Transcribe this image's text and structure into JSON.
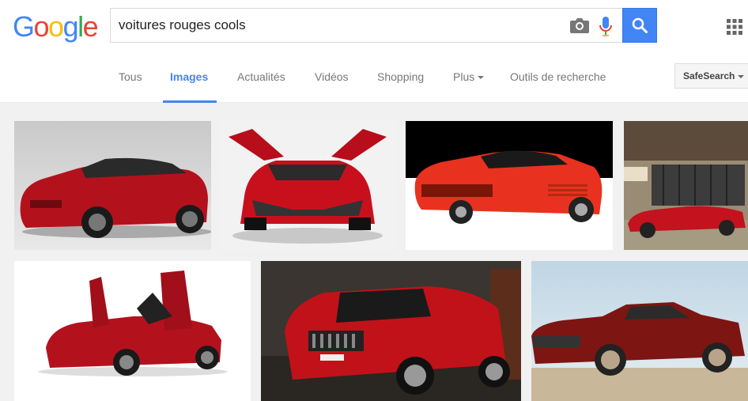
{
  "logo": {
    "letters": [
      "G",
      "o",
      "o",
      "g",
      "l",
      "e"
    ],
    "colors": [
      "#4285f4",
      "#ea4335",
      "#fbbc05",
      "#4285f4",
      "#34a853",
      "#ea4335"
    ]
  },
  "search": {
    "query": "voitures rouges cools"
  },
  "icons": {
    "camera": "camera-icon",
    "mic": "microphone-icon",
    "search": "search-icon",
    "apps": "apps-grid-icon"
  },
  "tabs": [
    {
      "label": "Tous"
    },
    {
      "label": "Images"
    },
    {
      "label": "Actualités"
    },
    {
      "label": "Vidéos"
    },
    {
      "label": "Shopping"
    },
    {
      "label": "Plus"
    },
    {
      "label": "Outils de recherche"
    }
  ],
  "safesearch": {
    "label": "SafeSearch"
  },
  "colors": {
    "accent": "#4285f4",
    "tab_text": "#777777",
    "background": "#f1f1f1"
  },
  "results": [
    {
      "description": "red sedan"
    },
    {
      "description": "red concept car with gullwing doors"
    },
    {
      "description": "red sports car rear view"
    },
    {
      "description": "red car in front of old building"
    },
    {
      "description": "red supercar with open doors"
    },
    {
      "description": "red SUV"
    },
    {
      "description": "red classic muscle car"
    }
  ]
}
